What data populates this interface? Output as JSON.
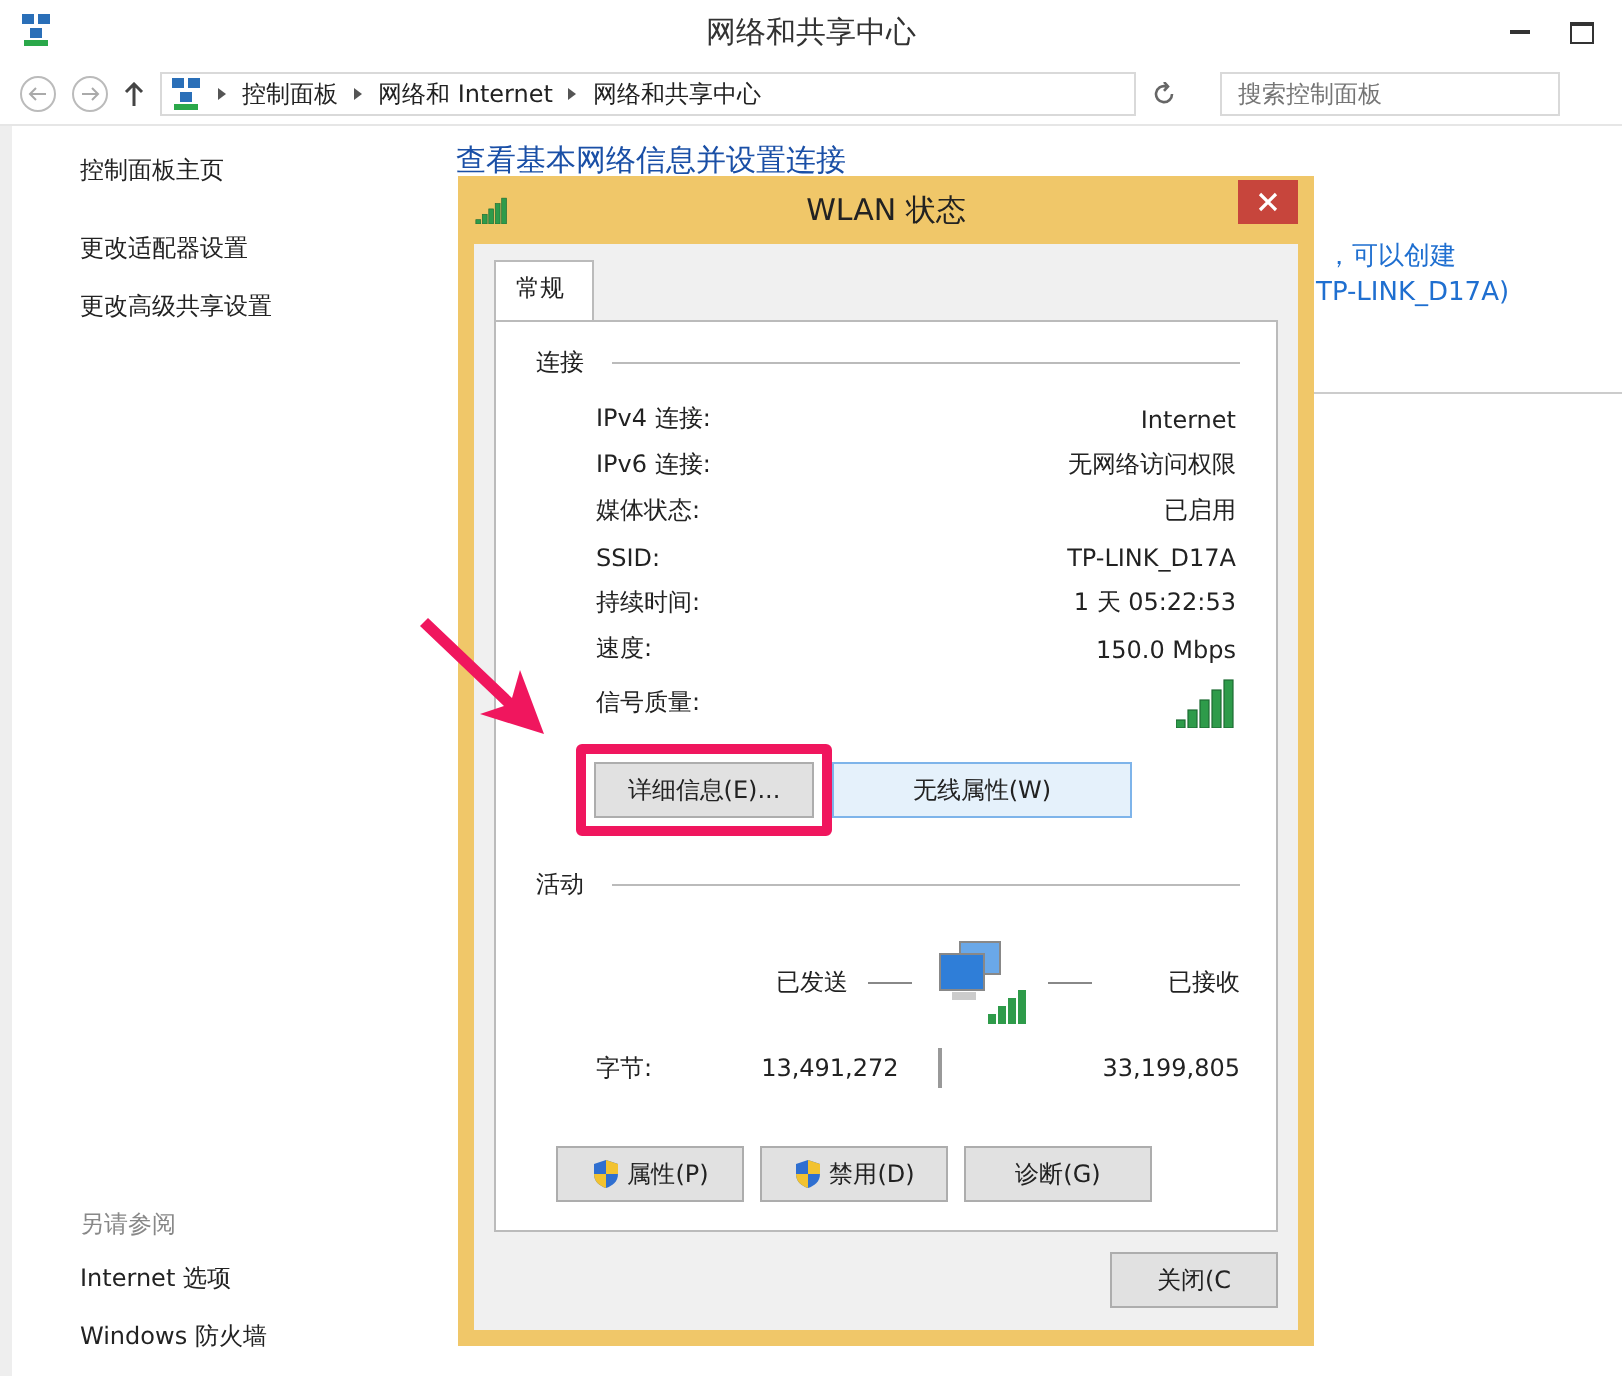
{
  "window": {
    "title": "网络和共享中心"
  },
  "address_bar": {
    "breadcrumbs": [
      "控制面板",
      "网络和 Internet",
      "网络和共享中心"
    ]
  },
  "search": {
    "placeholder": "搜索控制面板"
  },
  "sidebar": {
    "items": [
      "控制面板主页",
      "更改适配器设置",
      "更改高级共享设置"
    ],
    "see_also_title": "另请参阅",
    "see_also": [
      "Internet 选项",
      "Windows 防火墙"
    ]
  },
  "main": {
    "heading": "查看基本网络信息并设置连接",
    "fragments": [
      "，可以创建",
      "TP-LINK_D17A)"
    ]
  },
  "dialog": {
    "title": "WLAN 状态",
    "tabs": [
      {
        "label": "常规",
        "selected": true
      }
    ],
    "connection_title": "连接",
    "fields": [
      {
        "kind": "text",
        "label": "IPv4 连接:",
        "value": "Internet"
      },
      {
        "kind": "text",
        "label": "IPv6 连接:",
        "value": "无网络访问权限"
      },
      {
        "kind": "text",
        "label": "媒体状态:",
        "value": "已启用"
      },
      {
        "kind": "text",
        "label": "SSID:",
        "value": "TP-LINK_D17A"
      },
      {
        "kind": "text",
        "label": "持续时间:",
        "value": "1 天 05:22:53"
      },
      {
        "kind": "text",
        "label": "速度:",
        "value": "150.0 Mbps"
      },
      {
        "kind": "signal",
        "label": "信号质量:"
      }
    ],
    "buttons": [
      {
        "label": "详细信息(E)...",
        "highlighted": true
      },
      {
        "label": "无线属性(W)",
        "highlighted": false
      }
    ],
    "activity_title": "活动",
    "sent_label": "已发送",
    "received_label": "已接收",
    "bytes_label": "字节:",
    "bytes_sent": "13,491,272",
    "bytes_received": "33,199,805",
    "action_buttons": [
      {
        "label": "属性(P)",
        "shield": true
      },
      {
        "label": "禁用(D)",
        "shield": true
      },
      {
        "label": "诊断(G)",
        "shield": false
      }
    ],
    "close_button": "关闭(C"
  }
}
